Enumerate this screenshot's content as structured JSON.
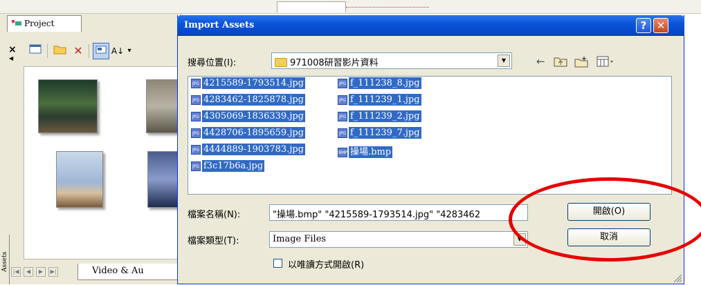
{
  "project_panel": {
    "tab_label": "Project",
    "vertical_tab_label": "Assets",
    "bottom_tab_label": "Video & Au",
    "toolbar_icons": [
      "panel-icon",
      "open-folder-icon",
      "delete-icon",
      "view-icon",
      "sort-icon"
    ]
  },
  "dialog": {
    "title": "Import Assets",
    "help_button": "?",
    "close_button": "✕",
    "look_in_label": "搜尋位置(I):",
    "look_in_value": "971008研習影片資料",
    "files": [
      {
        "name": "4215589-1793514.jpg",
        "type": "JPG"
      },
      {
        "name": "4283462-1825878.jpg",
        "type": "JPG"
      },
      {
        "name": "4305069-1836339.jpg",
        "type": "JPG"
      },
      {
        "name": "4428706-1895659.jpg",
        "type": "JPG"
      },
      {
        "name": "4444889-1903783.jpg",
        "type": "JPG"
      },
      {
        "name": "f3c17b6a.jpg",
        "type": "JPG"
      },
      {
        "name": "f_111238_8.jpg",
        "type": "JPG"
      },
      {
        "name": "f_111239_1.jpg",
        "type": "JPG"
      },
      {
        "name": "f_111239_2.jpg",
        "type": "JPG"
      },
      {
        "name": "f_111239_7.jpg",
        "type": "JPG"
      },
      {
        "name": "操場.bmp",
        "type": "BMP"
      }
    ],
    "filename_label": "檔案名稱(N):",
    "filename_value": "\"操場.bmp\" \"4215589-1793514.jpg\" \"4283462",
    "filetype_label": "檔案類型(T):",
    "filetype_value": "Image Files",
    "open_button": "開啟(O)",
    "cancel_button": "取消",
    "readonly_label": "以唯讀方式開啟(R)",
    "readonly_checked": false
  },
  "colors": {
    "title_bar": "#0a54d8",
    "selection": "#316ac5",
    "annotation": "#e60000"
  }
}
